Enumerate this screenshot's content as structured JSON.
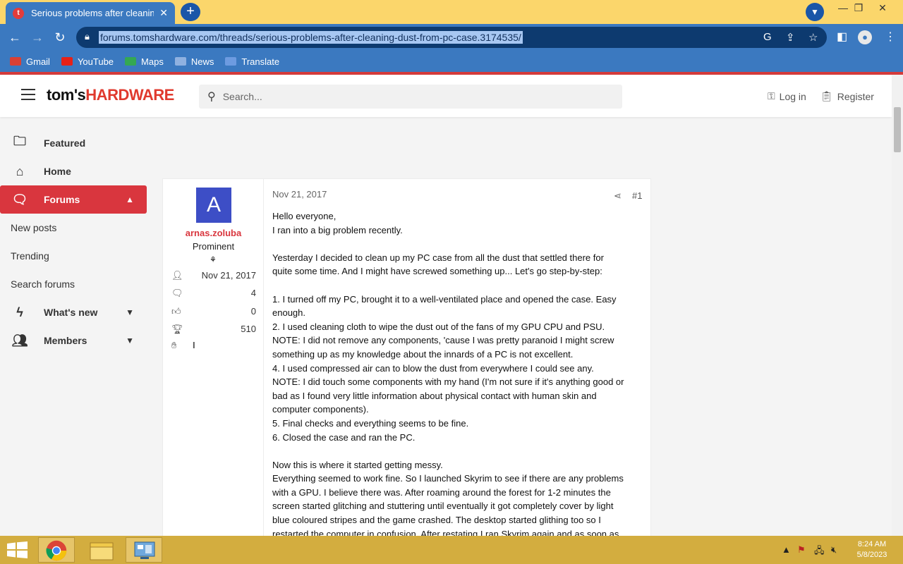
{
  "browser": {
    "tab_title": "Serious problems after cleaning d",
    "tab_close": "✕",
    "new_tab": "+",
    "url": "forums.tomshardware.com/threads/serious-problems-after-cleaning-dust-from-pc-case.3174535/",
    "bookmarks": [
      {
        "label": "Gmail",
        "icon": "gmail-icon",
        "color": "#d94034"
      },
      {
        "label": "YouTube",
        "icon": "youtube-icon",
        "color": "#e62117"
      },
      {
        "label": "Maps",
        "icon": "maps-icon",
        "color": "#34a853"
      },
      {
        "label": "News",
        "icon": "news-icon",
        "color": "#4285f4"
      },
      {
        "label": "Translate",
        "icon": "translate-icon",
        "color": "#4285f4"
      }
    ]
  },
  "site": {
    "logo_part1": "tom's",
    "logo_part2": "HARDWARE",
    "search_placeholder": "Search...",
    "login": "Log in",
    "register": "Register",
    "accent": "#d9363e"
  },
  "sidebar": {
    "items": [
      {
        "label": "Featured",
        "icon": "folder-icon"
      },
      {
        "label": "Home",
        "icon": "home-icon"
      },
      {
        "label": "Forums",
        "icon": "forums-icon"
      },
      {
        "label": "New posts"
      },
      {
        "label": "Trending"
      },
      {
        "label": "Search forums"
      },
      {
        "label": "What's new",
        "icon": "bolt-icon"
      },
      {
        "label": "Members",
        "icon": "members-icon"
      }
    ]
  },
  "post": {
    "avatar_letter": "A",
    "username": "arnas.zoluba",
    "user_title": "Prominent",
    "joined": "Nov 21, 2017",
    "messages": "4",
    "reactions": "0",
    "points": "510",
    "date": "Nov 21, 2017",
    "number": "#1",
    "lines": [
      "Hello everyone,",
      "I ran into a big problem recently.",
      "",
      "Yesterday I decided to clean up my PC case from all the dust that settled there for",
      "quite some time. And I might have screwed something up... Let's go step-by-step:",
      "",
      "1. I turned off my PC, brought it to a well-ventilated place and opened the case. Easy",
      "enough.",
      "2. I used cleaning cloth to wipe the dust out of the fans of my GPU CPU and PSU.",
      "NOTE: I did not remove any components, 'cause I was pretty paranoid I might screw",
      "something up as my knowledge about the innards of a PC is not excellent.",
      "4. I used compressed air can to blow the dust from everywhere I could see any.",
      "NOTE: I did touch some components with my hand (I'm not sure if it's anything good or",
      "bad as I found very little information about physical contact with human skin and",
      "computer components).",
      "5. Final checks and everything seems to be fine.",
      "6. Closed the case and ran the PC.",
      "",
      "Now this is where it started getting messy.",
      "Everything seemed to work fine. So I launched Skyrim to see if there are any problems",
      "with a GPU. I believe there was. After roaming around the forest for 1-2 minutes the",
      "screen started glitching and stuttering until eventually it got completely cover by light",
      "blue coloured stripes and the game crashed. The desktop started glithing too so I",
      "restarted the computer in confusion. After restating I ran Skyrim again and as soon as"
    ]
  },
  "taskbar": {
    "time": "8:24 AM",
    "date": "5/8/2023"
  }
}
